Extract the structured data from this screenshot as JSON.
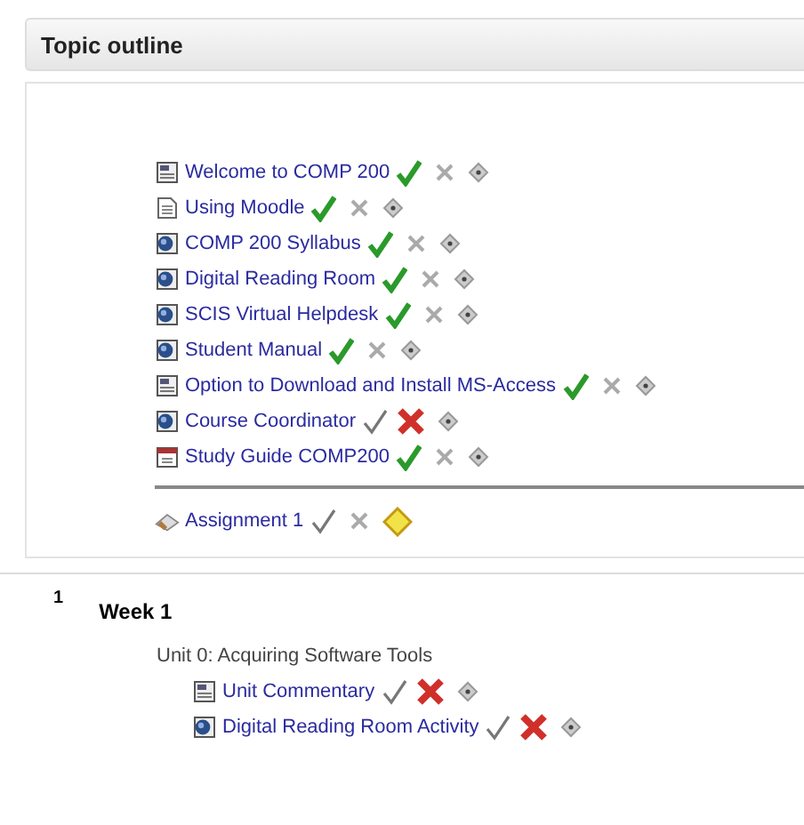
{
  "header": {
    "title": "Topic outline"
  },
  "sections": [
    {
      "items": [
        {
          "kind": "page",
          "title": "Welcome to COMP 200",
          "checked": true,
          "crossed": false,
          "highlighted": false
        },
        {
          "kind": "text",
          "title": "Using Moodle",
          "checked": true,
          "crossed": false,
          "highlighted": false
        },
        {
          "kind": "web",
          "title": "COMP 200 Syllabus",
          "checked": true,
          "crossed": false,
          "highlighted": false
        },
        {
          "kind": "web",
          "title": "Digital Reading Room",
          "checked": true,
          "crossed": false,
          "highlighted": false
        },
        {
          "kind": "web",
          "title": "SCIS Virtual Helpdesk",
          "checked": true,
          "crossed": false,
          "highlighted": false
        },
        {
          "kind": "web",
          "title": "Student Manual",
          "checked": true,
          "crossed": false,
          "highlighted": false
        },
        {
          "kind": "page",
          "title": "Option to Download and Install MS-Access",
          "checked": true,
          "crossed": false,
          "highlighted": false
        },
        {
          "kind": "web",
          "title": "Course Coordinator",
          "checked": false,
          "crossed": true,
          "highlighted": false
        },
        {
          "kind": "calendar",
          "title": "Study Guide COMP200",
          "checked": true,
          "crossed": false,
          "highlighted": false
        }
      ],
      "assignments": [
        {
          "kind": "assignment",
          "title": "Assignment 1",
          "checked": false,
          "crossed": false,
          "highlighted": true
        }
      ]
    },
    {
      "number": "1",
      "title": "Week 1",
      "label": "Unit 0: Acquiring Software Tools",
      "items": [
        {
          "kind": "page",
          "title": "Unit Commentary",
          "checked": false,
          "crossed": true,
          "highlighted": false
        },
        {
          "kind": "web",
          "title": "Digital Reading Room Activity",
          "checked": false,
          "crossed": true,
          "highlighted": false
        }
      ]
    }
  ]
}
